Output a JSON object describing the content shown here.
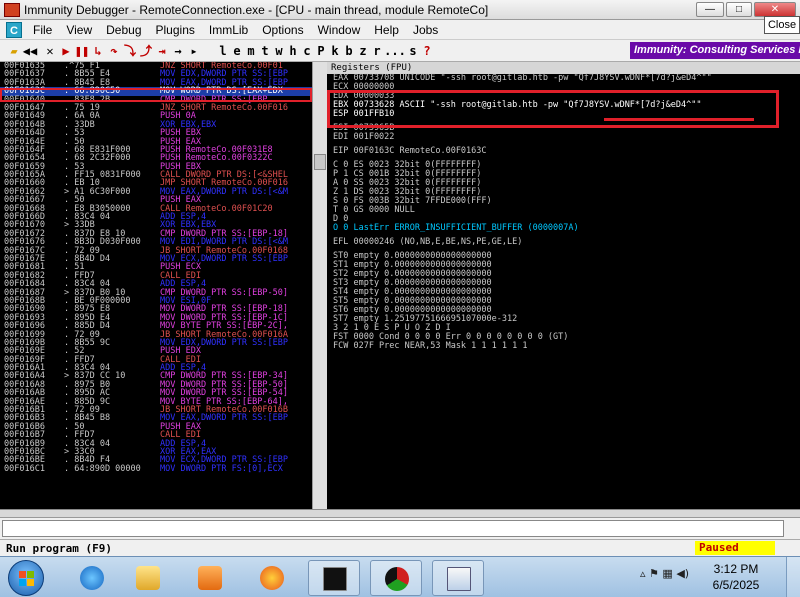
{
  "window": {
    "title": "Immunity Debugger - RemoteConnection.exe - [CPU - main thread, module RemoteCo]",
    "close_tooltip": "Close"
  },
  "menu": [
    "File",
    "View",
    "Debug",
    "Plugins",
    "ImmLib",
    "Options",
    "Window",
    "Help",
    "Jobs"
  ],
  "toolbar": {
    "letters": [
      "l",
      "e",
      "m",
      "t",
      "w",
      "h",
      "c",
      "P",
      "k",
      "b",
      "z",
      "r",
      "...",
      "s",
      "?"
    ],
    "banner": "Immunity: Consulting Services Ma"
  },
  "cpu": {
    "rows": [
      {
        "addr": "00F01635",
        "hex": ".^75 F1",
        "asm": "JNZ SHORT RemoteCo.00F01",
        "cls": "c-jmp"
      },
      {
        "addr": "00F01637",
        "hex": ". 8B55 E4",
        "asm": "MOV EDX,DWORD PTR SS:[EBP",
        "cls": "c-mov"
      },
      {
        "addr": "00F0163A",
        "hex": ". 8B45 E8",
        "asm": "MOV EAX,DWORD PTR SS:[EBP",
        "cls": "c-mov"
      },
      {
        "addr": "00F0163C",
        "hex": ". 66:890C50",
        "asm": "MOV WORD PTR DS:[EAX+EDX",
        "cls": "c-mov",
        "sel": true
      },
      {
        "addr": "00F01640",
        "hex": ". 83F8 2B",
        "asm": "CMP DWORD PTR SS:[EBP",
        "cls": "c-cmp"
      },
      {
        "addr": "00F01647",
        "hex": ". 75 19",
        "asm": "JNZ SHORT RemoteCo.00F016",
        "cls": "c-jmp"
      },
      {
        "addr": "00F01649",
        "hex": ". 6A 0A",
        "asm": "PUSH 0A",
        "cls": "c-push"
      },
      {
        "addr": "00F0164B",
        "hex": ". 33DB",
        "asm": "XOR EBX,EBX",
        "cls": "c-xor"
      },
      {
        "addr": "00F0164D",
        "hex": ". 53",
        "asm": "PUSH EBX",
        "cls": "c-push"
      },
      {
        "addr": "00F0164E",
        "hex": ". 50",
        "asm": "PUSH EAX",
        "cls": "c-push"
      },
      {
        "addr": "00F0164F",
        "hex": ". 68 E831F000",
        "asm": "PUSH RemoteCo.00F031E8",
        "cls": "c-push"
      },
      {
        "addr": "00F01654",
        "hex": ". 68 2C32F000",
        "asm": "PUSH RemoteCo.00F0322C",
        "cls": "c-push"
      },
      {
        "addr": "00F01659",
        "hex": ". 53",
        "asm": "PUSH EBX",
        "cls": "c-push"
      },
      {
        "addr": "00F0165A",
        "hex": ". FF15 0831F000",
        "asm": "CALL DWORD PTR DS:[<&SHEL",
        "cls": "c-call"
      },
      {
        "addr": "00F01660",
        "hex": ". EB 10",
        "asm": "JMP SHORT RemoteCo.00F016",
        "cls": "c-jmp"
      },
      {
        "addr": "00F01662",
        "hex": "> A1 6C30F000",
        "asm": "MOV EAX,DWORD PTR DS:[<&M",
        "cls": "c-mov"
      },
      {
        "addr": "00F01667",
        "hex": ". 50",
        "asm": "PUSH EAX",
        "cls": "c-push"
      },
      {
        "addr": "00F01668",
        "hex": ". E8 B3050000",
        "asm": "CALL RemoteCo.00F01C20",
        "cls": "c-call"
      },
      {
        "addr": "00F0166D",
        "hex": ". 83C4 04",
        "asm": "ADD ESP,4",
        "cls": "c-add"
      },
      {
        "addr": "00F01670",
        "hex": "> 33DB",
        "asm": "XOR EBX,EBX",
        "cls": "c-xor"
      },
      {
        "addr": "00F01672",
        "hex": ". 837D E8 10",
        "asm": "CMP DWORD PTR SS:[EBP-18]",
        "cls": "c-cmp"
      },
      {
        "addr": "00F01676",
        "hex": ". 8B3D D030F000",
        "asm": "MOV EDI,DWORD PTR DS:[<&M",
        "cls": "c-mov"
      },
      {
        "addr": "00F0167C",
        "hex": ". 72 09",
        "asm": "JB SHORT RemoteCo.00F0168",
        "cls": "c-jmp"
      },
      {
        "addr": "00F0167E",
        "hex": ". 8B4D D4",
        "asm": "MOV ECX,DWORD PTR SS:[EBP",
        "cls": "c-mov"
      },
      {
        "addr": "00F01681",
        "hex": ". 51",
        "asm": "PUSH ECX",
        "cls": "c-push"
      },
      {
        "addr": "00F01682",
        "hex": ". FFD7",
        "asm": "CALL EDI",
        "cls": "c-call"
      },
      {
        "addr": "00F01684",
        "hex": ". 83C4 04",
        "asm": "ADD ESP,4",
        "cls": "c-add"
      },
      {
        "addr": "00F01687",
        "hex": "> 837D B0 10",
        "asm": "CMP DWORD PTR SS:[EBP-50]",
        "cls": "c-cmp"
      },
      {
        "addr": "00F0168B",
        "hex": ". BE 0F000000",
        "asm": "MOV ESI,0F",
        "cls": "c-mov"
      },
      {
        "addr": "00F01690",
        "hex": ". 8975 E8",
        "asm": "MOV DWORD PTR SS:[EBP-18]",
        "cls": "c-cmp"
      },
      {
        "addr": "00F01693",
        "hex": ". 895D E4",
        "asm": "MOV DWORD PTR SS:[EBP-1C]",
        "cls": "c-cmp"
      },
      {
        "addr": "00F01696",
        "hex": ". 885D D4",
        "asm": "MOV BYTE PTR SS:[EBP-2C],",
        "cls": "c-cmp"
      },
      {
        "addr": "00F01699",
        "hex": ". 72 09",
        "asm": "JB SHORT RemoteCo.00F016A",
        "cls": "c-jmp"
      },
      {
        "addr": "00F0169B",
        "hex": ". 8B55 9C",
        "asm": "MOV EDX,DWORD PTR SS:[EBP",
        "cls": "c-mov"
      },
      {
        "addr": "00F0169E",
        "hex": ". 52",
        "asm": "PUSH EDX",
        "cls": "c-push"
      },
      {
        "addr": "00F0169F",
        "hex": ". FFD7",
        "asm": "CALL EDI",
        "cls": "c-call"
      },
      {
        "addr": "00F016A1",
        "hex": ". 83C4 04",
        "asm": "ADD ESP,4",
        "cls": "c-add"
      },
      {
        "addr": "00F016A4",
        "hex": "> 837D CC 10",
        "asm": "CMP DWORD PTR SS:[EBP-34]",
        "cls": "c-cmp"
      },
      {
        "addr": "00F016A8",
        "hex": ". 8975 B0",
        "asm": "MOV DWORD PTR SS:[EBP-50]",
        "cls": "c-cmp"
      },
      {
        "addr": "00F016AB",
        "hex": ". 895D AC",
        "asm": "MOV DWORD PTR SS:[EBP-54]",
        "cls": "c-cmp"
      },
      {
        "addr": "00F016AE",
        "hex": ". 885D 9C",
        "asm": "MOV BYTE PTR SS:[EBP-64],",
        "cls": "c-cmp"
      },
      {
        "addr": "00F016B1",
        "hex": ". 72 09",
        "asm": "JB SHORT RemoteCo.00F016B",
        "cls": "c-jmp"
      },
      {
        "addr": "00F016B3",
        "hex": ". 8B45 B8",
        "asm": "MOV EAX,DWORD PTR SS:[EBP",
        "cls": "c-mov"
      },
      {
        "addr": "00F016B6",
        "hex": ". 50",
        "asm": "PUSH EAX",
        "cls": "c-push"
      },
      {
        "addr": "00F016B7",
        "hex": ". FFD7",
        "asm": "CALL EDI",
        "cls": "c-call"
      },
      {
        "addr": "00F016B9",
        "hex": ". 83C4 04",
        "asm": "ADD ESP,4",
        "cls": "c-add"
      },
      {
        "addr": "00F016BC",
        "hex": "> 33C0",
        "asm": "XOR EAX,EAX",
        "cls": "c-xor"
      },
      {
        "addr": "00F016BE",
        "hex": ". 8B4D F4",
        "asm": "MOV ECX,DWORD PTR SS:[EBP",
        "cls": "c-mov"
      },
      {
        "addr": "00F016C1",
        "hex": ". 64:890D 00000",
        "asm": "MOV DWORD PTR FS:[0],ECX",
        "cls": "c-mov"
      }
    ]
  },
  "registers": {
    "header": "Registers (FPU)",
    "lines": [
      "EAX 00733708 UNICODE \"-ssh root@gitlab.htb -pw \"Qf7J8YSV.wDNF*[7d?j&eD4^\"\"",
      "ECX 00000000",
      "EDX 00000033",
      "EBX 00733628 ASCII \"-ssh root@gitlab.htb -pw \"Qf7J8YSV.wDNF*[7d?j&eD4^\"\"",
      "ESP 001FFB10",
      "",
      "ESI 0073965B",
      "EDI 001F0022",
      "",
      "EIP 00F0163C RemoteCo.00F0163C",
      "",
      "C 0  ES 0023 32bit 0(FFFFFFFF)",
      "P 1  CS 001B 32bit 0(FFFFFFFF)",
      "A 0  SS 0023 32bit 0(FFFFFFFF)",
      "Z 1  DS 0023 32bit 0(FFFFFFFF)",
      "S 0  FS 003B 32bit 7FFDE000(FFF)",
      "T 0  GS 0000 NULL",
      "D 0",
      "O 0  LastErr ERROR_INSUFFICIENT_BUFFER (0000007A)",
      "",
      "EFL 00000246 (NO,NB,E,BE,NS,PE,GE,LE)",
      "",
      "ST0 empty 0.0000000000000000000",
      "ST1 empty 0.0000000000000000000",
      "ST2 empty 0.0000000000000000000",
      "ST3 empty 0.0000000000000000000",
      "ST4 empty 0.0000000000000000000",
      "ST5 empty 0.0000000000000000000",
      "ST6 empty 0.0000000000000000000",
      "ST7 empty 1.2519775166695107000e-312",
      "               3 2 1 0      E S P U O Z D I",
      "FST 0000  Cond 0 0 0 0  Err 0 0 0 0 0 0 0 0  (GT)",
      "FCW 027F  Prec NEAR,53  Mask    1 1 1 1 1 1"
    ]
  },
  "status": {
    "message": "Run program (F9)",
    "state": "Paused"
  },
  "taskbar": {
    "time": "3:12 PM",
    "date": "6/5/2025"
  }
}
